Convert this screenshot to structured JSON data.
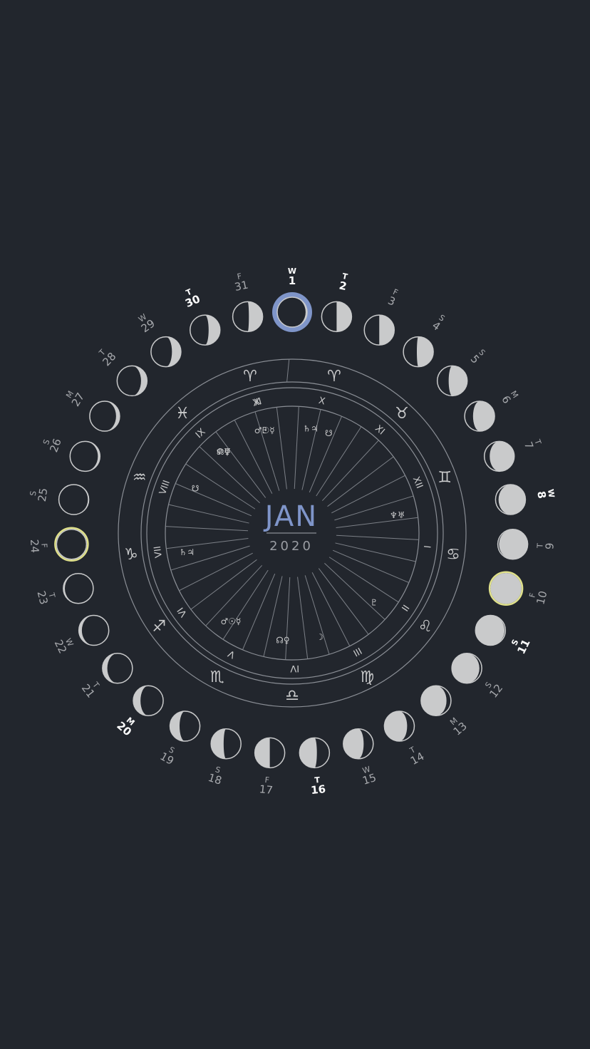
{
  "calendar": {
    "month": "JAN",
    "year": "2020",
    "colors": {
      "background": "#22262d",
      "ink": "#c9cacb",
      "lines": "#8a8e95",
      "accent": "#7f95c9",
      "highlight_ring": "#dfe08a"
    },
    "days": [
      {
        "day": "1",
        "weekday": "W",
        "bold": true,
        "phase": 0.05,
        "waxing": true,
        "today": true
      },
      {
        "day": "2",
        "weekday": "T",
        "bold": true,
        "phase": 0.5,
        "waxing": true
      },
      {
        "day": "3",
        "weekday": "F",
        "bold": false,
        "phase": 0.5,
        "waxing": true
      },
      {
        "day": "4",
        "weekday": "S",
        "bold": false,
        "phase": 0.55,
        "waxing": true
      },
      {
        "day": "5",
        "weekday": "S",
        "bold": false,
        "phase": 0.62,
        "waxing": true
      },
      {
        "day": "6",
        "weekday": "M",
        "bold": false,
        "phase": 0.72,
        "waxing": true
      },
      {
        "day": "7",
        "weekday": "T",
        "bold": false,
        "phase": 0.82,
        "waxing": true
      },
      {
        "day": "8",
        "weekday": "W",
        "bold": true,
        "phase": 0.9,
        "waxing": true
      },
      {
        "day": "9",
        "weekday": "T",
        "bold": false,
        "phase": 0.96,
        "waxing": true
      },
      {
        "day": "10",
        "weekday": "F",
        "bold": false,
        "phase": 1.0,
        "waxing": true,
        "full_moon": true
      },
      {
        "day": "11",
        "weekday": "S",
        "bold": true,
        "phase": 0.97,
        "waxing": false
      },
      {
        "day": "12",
        "weekday": "S",
        "bold": false,
        "phase": 0.92,
        "waxing": false
      },
      {
        "day": "13",
        "weekday": "M",
        "bold": false,
        "phase": 0.85,
        "waxing": false
      },
      {
        "day": "14",
        "weekday": "T",
        "bold": false,
        "phase": 0.76,
        "waxing": false
      },
      {
        "day": "15",
        "weekday": "W",
        "bold": false,
        "phase": 0.68,
        "waxing": false
      },
      {
        "day": "16",
        "weekday": "T",
        "bold": true,
        "phase": 0.58,
        "waxing": false
      },
      {
        "day": "17",
        "weekday": "F",
        "bold": false,
        "phase": 0.5,
        "waxing": false
      },
      {
        "day": "18",
        "weekday": "S",
        "bold": false,
        "phase": 0.42,
        "waxing": false
      },
      {
        "day": "19",
        "weekday": "S",
        "bold": false,
        "phase": 0.32,
        "waxing": false
      },
      {
        "day": "20",
        "weekday": "M",
        "bold": true,
        "phase": 0.24,
        "waxing": false
      },
      {
        "day": "21",
        "weekday": "T",
        "bold": false,
        "phase": 0.16,
        "waxing": false
      },
      {
        "day": "22",
        "weekday": "W",
        "bold": false,
        "phase": 0.1,
        "waxing": false
      },
      {
        "day": "23",
        "weekday": "T",
        "bold": false,
        "phase": 0.05,
        "waxing": false
      },
      {
        "day": "24",
        "weekday": "F",
        "bold": false,
        "phase": 0.0,
        "waxing": false,
        "new_moon": true
      },
      {
        "day": "25",
        "weekday": "S",
        "bold": false,
        "phase": 0.03,
        "waxing": true
      },
      {
        "day": "26",
        "weekday": "S",
        "bold": false,
        "phase": 0.07,
        "waxing": true
      },
      {
        "day": "27",
        "weekday": "M",
        "bold": false,
        "phase": 0.12,
        "waxing": true
      },
      {
        "day": "28",
        "weekday": "T",
        "bold": false,
        "phase": 0.2,
        "waxing": true
      },
      {
        "day": "29",
        "weekday": "W",
        "bold": false,
        "phase": 0.3,
        "waxing": true
      },
      {
        "day": "30",
        "weekday": "T",
        "bold": true,
        "phase": 0.38,
        "waxing": true
      },
      {
        "day": "31",
        "weekday": "F",
        "bold": false,
        "phase": 0.46,
        "waxing": true
      }
    ],
    "zodiac_signs": [
      "♈",
      "♉",
      "♊",
      "♋",
      "♌",
      "♍",
      "♎",
      "♏",
      "♐",
      "♑",
      "♒",
      "♓",
      "♈"
    ],
    "houses": [
      "XI",
      "X",
      "XI",
      "XII",
      "I",
      "II",
      "III",
      "IV",
      "V",
      "VI",
      "VII",
      "VIII",
      "IX",
      "X"
    ],
    "planet_glyphs": [
      "☊♀",
      "♂☉☿",
      "♄♃",
      "☋",
      "♆♅",
      "♇",
      "☽"
    ]
  }
}
